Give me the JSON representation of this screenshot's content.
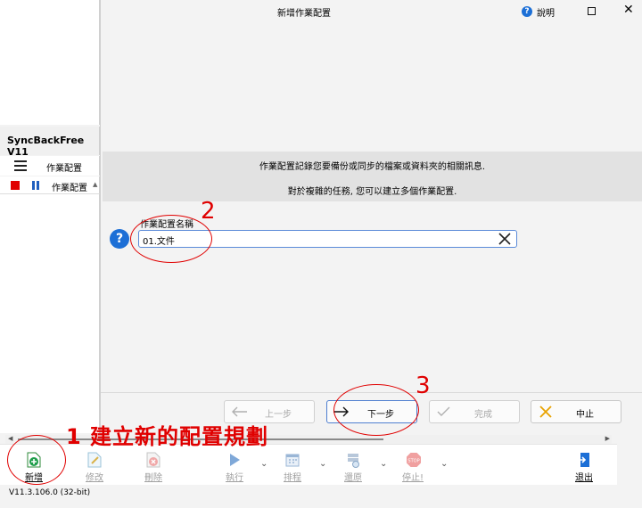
{
  "main_window": {
    "app_title": "SyncBackFree V11",
    "menu_label": "作業配置",
    "column_header": "作業配置",
    "status": "V11.3.106.0 (32-bit)"
  },
  "toolbar": {
    "new": "新增",
    "edit": "修改",
    "delete": "刪除",
    "run": "執行",
    "schedule": "排程",
    "restore": "還原",
    "stop": "停止!",
    "exit": "退出"
  },
  "dialog": {
    "title": "新增作業配置",
    "help_label": "說明",
    "info_line1": "作業配置記錄您要備份或同步的檔案或資料夾的相關訊息.",
    "info_line2": "對於複雜的任務, 您可以建立多個作業配置.",
    "field_label": "作業配置名稱",
    "field_value": "01.文件",
    "buttons": {
      "prev": "上一步",
      "next": "下一步",
      "finish": "完成",
      "cancel": "中止"
    }
  },
  "annotations": {
    "step1": "1 建立新的配置規劃",
    "step2": "2",
    "step3": "3"
  },
  "colors": {
    "accent": "#1c6fd6",
    "annotation": "#e00000"
  }
}
